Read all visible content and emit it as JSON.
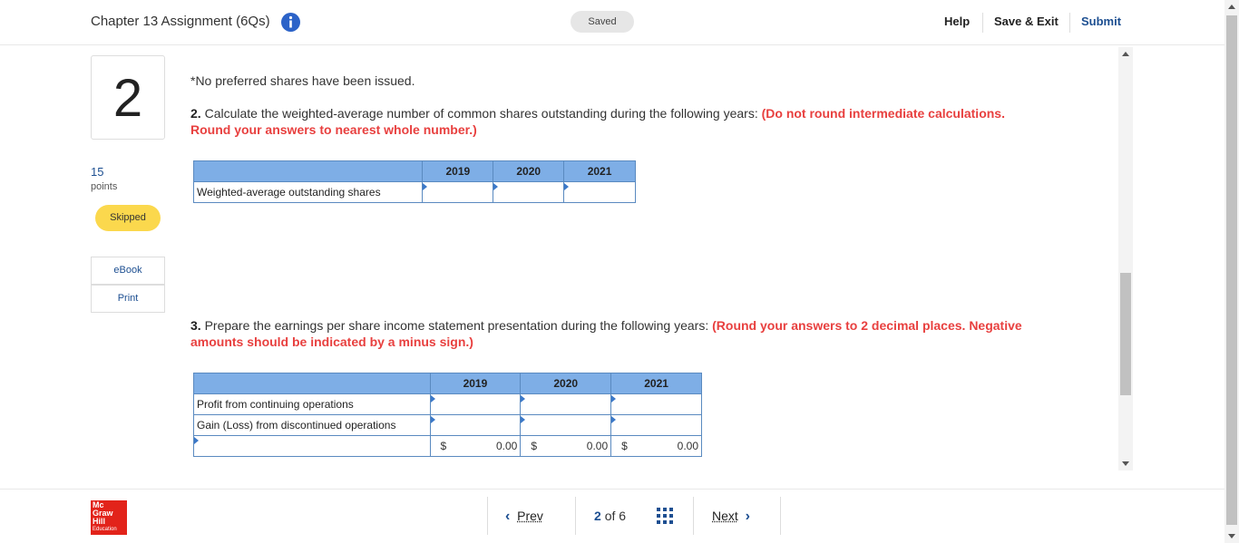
{
  "header": {
    "title": "Chapter 13 Assignment (6Qs)",
    "saved": "Saved",
    "help": "Help",
    "save_exit": "Save & Exit",
    "submit": "Submit"
  },
  "sidebar": {
    "question_number": "2",
    "points": "15",
    "points_label": "points",
    "status": "Skipped",
    "ebook": "eBook",
    "print": "Print"
  },
  "question": {
    "note": "*No preferred shares have been issued.",
    "part2_num": "2.",
    "part2_text": "Calculate the weighted-average number of common shares outstanding during the following years:",
    "part2_instr": "(Do not round intermediate calculations. Round your answers to nearest whole number.)",
    "table1": {
      "headers": [
        "2019",
        "2020",
        "2021"
      ],
      "row_label": "Weighted-average outstanding shares"
    },
    "part3_num": "3.",
    "part3_text": "Prepare the earnings per share income statement presentation during the following years:",
    "part3_instr": "(Round your answers to 2 decimal places. Negative amounts should be indicated by a minus sign.)",
    "table2": {
      "headers": [
        "2019",
        "2020",
        "2021"
      ],
      "rows": [
        "Profit from continuing operations",
        "Gain (Loss) from discontinued operations"
      ],
      "total_currency": "$",
      "totals": [
        "0.00",
        "0.00",
        "0.00"
      ]
    }
  },
  "footer": {
    "logo_lines": [
      "Mc",
      "Graw",
      "Hill",
      "Education"
    ],
    "prev": "Prev",
    "current": "2",
    "of": "of",
    "total": "6",
    "next": "Next"
  },
  "colors": {
    "accent": "#1d4f91",
    "instruction_red": "#e8403f",
    "table_header": "#7eaee6",
    "skipped_badge": "#fbd84d"
  }
}
